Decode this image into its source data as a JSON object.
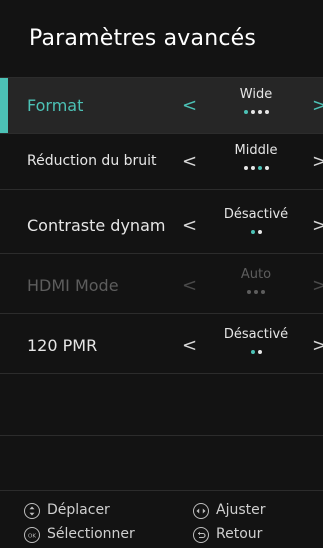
{
  "header": {
    "title": "Paramètres avancés"
  },
  "settings": [
    {
      "label": "Format",
      "value": "Wide",
      "dot_count": 4,
      "selected_dot": 1,
      "state": "focused"
    },
    {
      "label": "Réduction du bruit",
      "value": "Middle",
      "dot_count": 4,
      "selected_dot": 3,
      "state": "normal"
    },
    {
      "label": "Contraste dynam",
      "value": "Désactivé",
      "dot_count": 2,
      "selected_dot": 1,
      "state": "normal"
    },
    {
      "label": "HDMI Mode",
      "value": "Auto",
      "dot_count": 3,
      "selected_dot": 1,
      "state": "disabled"
    },
    {
      "label": "120 PMR",
      "value": "Désactivé",
      "dot_count": 2,
      "selected_dot": 1,
      "state": "normal"
    }
  ],
  "footer": {
    "move": "Déplacer",
    "adjust": "Ajuster",
    "select": "Sélectionner",
    "back": "Retour"
  },
  "colors": {
    "accent": "#4cc2b6",
    "background": "#131313",
    "focused_row": "#262626",
    "disabled_text": "#5d5d5d"
  },
  "icons": {
    "move": "up-down-arrows-icon",
    "adjust": "left-right-arrows-icon",
    "select": "ok-icon",
    "back": "return-arrow-icon"
  }
}
